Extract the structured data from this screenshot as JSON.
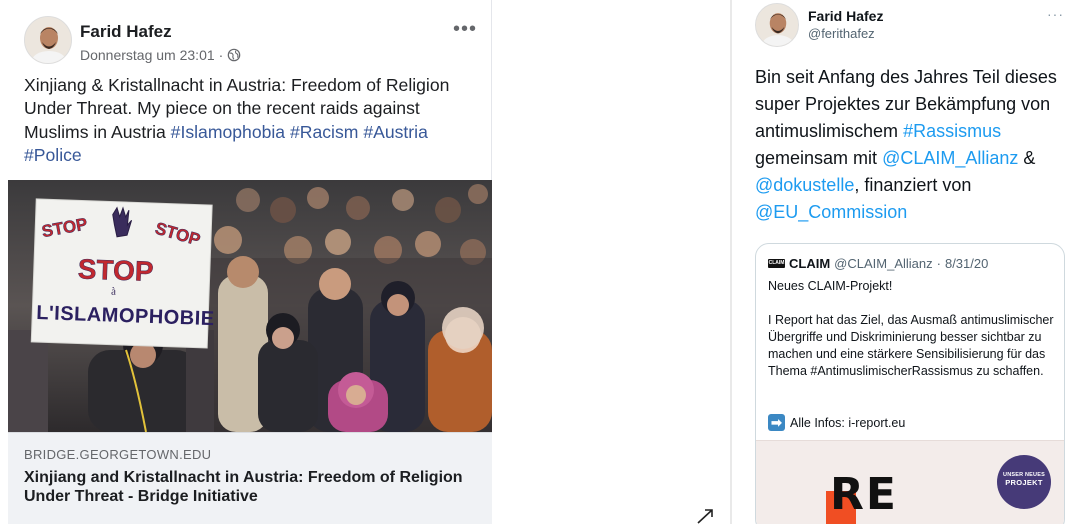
{
  "facebook": {
    "author": "Farid Hafez",
    "timestamp": "Donnerstag um 23:01",
    "separator": "·",
    "more_label": "•••",
    "post_text": "Xinjiang & Kristallnacht in Austria: Freedom of Religion Under Threat. My piece on the recent raids against Muslims in Austria",
    "hashtags": [
      "#Islamophobia",
      "#Racism",
      "#Austria",
      "#Police"
    ],
    "photo_sign": {
      "line1": "STOP",
      "line2": "STOP",
      "line3": "STOP",
      "line4": "à",
      "line5": "L'ISLAMOPHOBIE"
    },
    "link_domain": "BRIDGE.GEORGETOWN.EDU",
    "link_title": "Xinjiang and Kristallnacht in Austria: Freedom of Religion Under Threat - Bridge Initiative"
  },
  "twitter": {
    "author": "Farid Hafez",
    "handle": "@ferithafez",
    "more_label": "···",
    "text_part1": "Bin seit Anfang des Jahres Teil dieses super Projektes zur Bekämpfung von antimuslimischem",
    "tag_rassismus": "#Rassismus",
    "text_part2": "gemeinsam mit",
    "mention_claim": "@CLAIM_Allianz",
    "text_part3": "&",
    "mention_doku": "@dokustelle",
    "text_part4": ", finanziert von",
    "mention_eu": "@EU_Commission",
    "quote": {
      "logo_text": "CLAIM",
      "name": "CLAIM",
      "handle": "@CLAIM_Allianz",
      "date": "8/31/20",
      "dot": "·",
      "line1": "Neues CLAIM-Projekt!",
      "body": "I Report hat das Ziel, das Ausmaß antimuslimischer Übergriffe und Diskriminierung besser sichtbar zu machen und eine stärkere Sensibilisierung für das Thema #AntimuslimischerRassismus zu schaffen.",
      "info": "Alle Infos: i-report.eu",
      "badge_line1": "UNSER NEUES",
      "badge_line2": "PROJEKT",
      "image_text": "RE"
    }
  },
  "colors": {
    "fb_link": "#385898",
    "tw_link": "#1d9bf0",
    "badge": "#463a78",
    "accent_orange": "#f04e23"
  },
  "icons": [
    "globe-icon",
    "more-options-icon",
    "expand-icon",
    "right-arrow-icon"
  ]
}
